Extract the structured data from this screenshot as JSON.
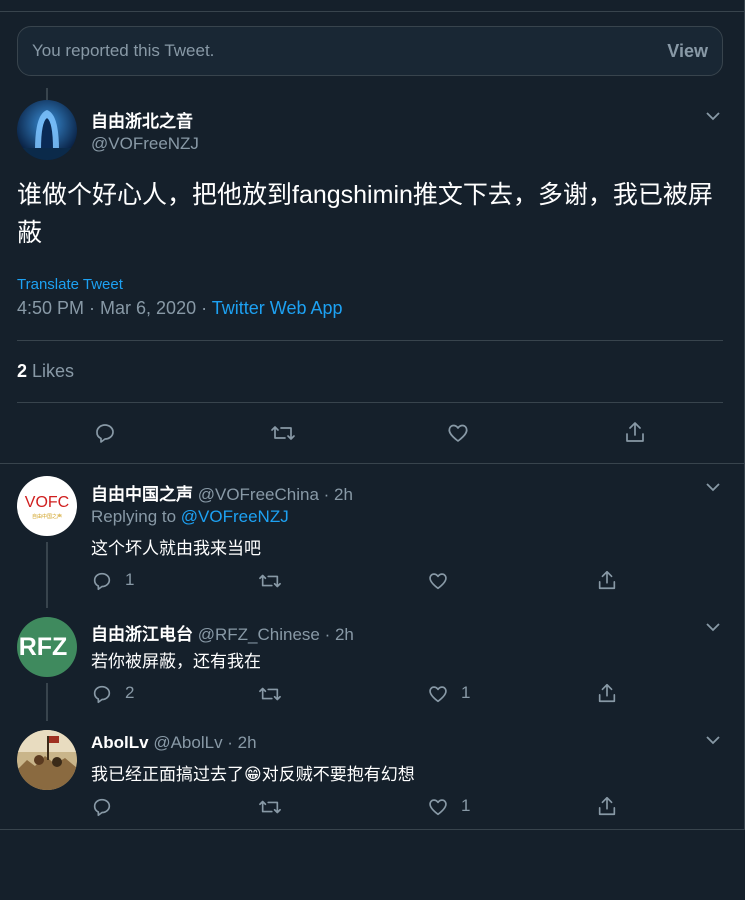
{
  "notice": {
    "text": "You reported this Tweet.",
    "view_label": "View"
  },
  "main_tweet": {
    "display_name": "自由浙北之音",
    "handle": "@VOFreeNZJ",
    "body": "谁做个好心人，把他放到fangshimin推文下去，多谢，我已被屏蔽",
    "translate": "Translate Tweet",
    "time": "4:50 PM · Mar 6, 2020 · ",
    "source": "Twitter Web App",
    "likes_count": "2",
    "likes_label": " Likes"
  },
  "replies": [
    {
      "display_name": "自由中国之声",
      "handle_time": " @VOFreeChina · 2h",
      "replying_prefix": "Replying to ",
      "replying_to": "@VOFreeNZJ",
      "body": "这个坏人就由我来当吧",
      "avatar_text": "VOFC",
      "avatar_subtext": "自由中国之声",
      "reply_count": "1",
      "like_count": ""
    },
    {
      "display_name": "自由浙江电台",
      "handle_time": " @RFZ_Chinese · 2h",
      "body": "若你被屏蔽，还有我在",
      "avatar_text": "RFZ",
      "reply_count": "2",
      "like_count": "1"
    },
    {
      "display_name": "AbolLv",
      "handle_time": " @AbolLv · 2h",
      "body": "我已经正面搞过去了😁对反贼不要抱有幻想",
      "reply_count": "",
      "like_count": "1"
    }
  ],
  "icons": [
    "chevron-down-icon",
    "reply-icon",
    "retweet-icon",
    "like-icon",
    "share-icon"
  ],
  "colors": {
    "background": "#15202b",
    "accent": "#1da1f2",
    "muted": "#8899a6",
    "border": "#38444d"
  }
}
